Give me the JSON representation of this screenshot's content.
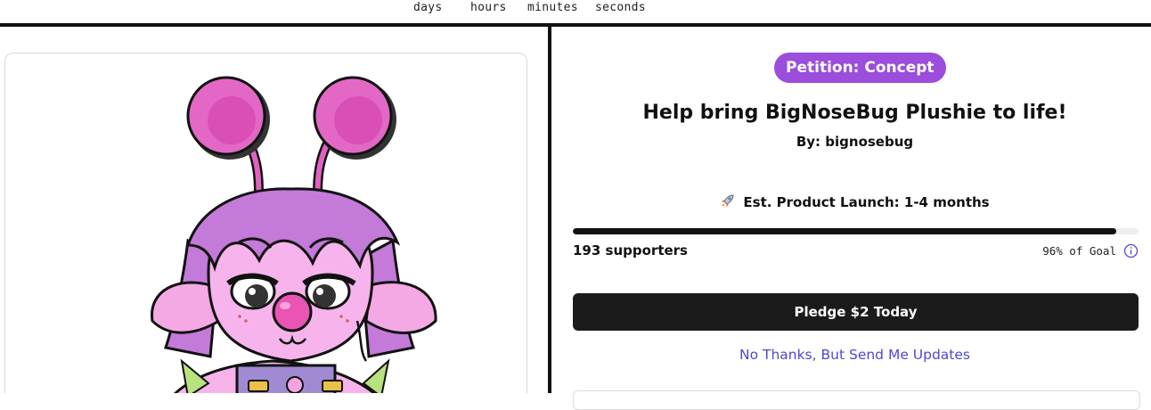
{
  "countdown": {
    "units": [
      "days",
      "hours",
      "minutes",
      "seconds"
    ]
  },
  "product": {
    "status_badge": "Petition: Concept",
    "title": "Help bring BigNoseBug Plushie to life!",
    "author": "By: bignosebug",
    "launch_estimate": "Est. Product Launch: 1-4 months",
    "progress": 0.96,
    "supporters": "193 supporters",
    "goal_text": "96% of Goal",
    "pledge_label": "Pledge $2 Today",
    "updates_label": "No Thanks, But Send Me Updates"
  },
  "icons": {
    "launch": "rocket-icon",
    "goal_info": "info-icon"
  },
  "colors": {
    "badge": "#9b4ddb",
    "button": "#1b1b1b",
    "link": "#4a4ad6",
    "progress": "#111111"
  }
}
